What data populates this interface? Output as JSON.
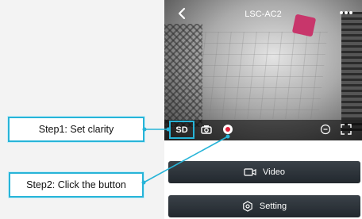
{
  "steps": {
    "step1": "Step1:  Set clarity",
    "step2": "Step2:  Click the button"
  },
  "header": {
    "title": "LSC-AC2"
  },
  "controls": {
    "quality_label": "SD"
  },
  "actions": {
    "video_label": "Video",
    "setting_label": "Setting"
  },
  "colors": {
    "callout": "#27b4d8",
    "record": "#e0203a"
  }
}
